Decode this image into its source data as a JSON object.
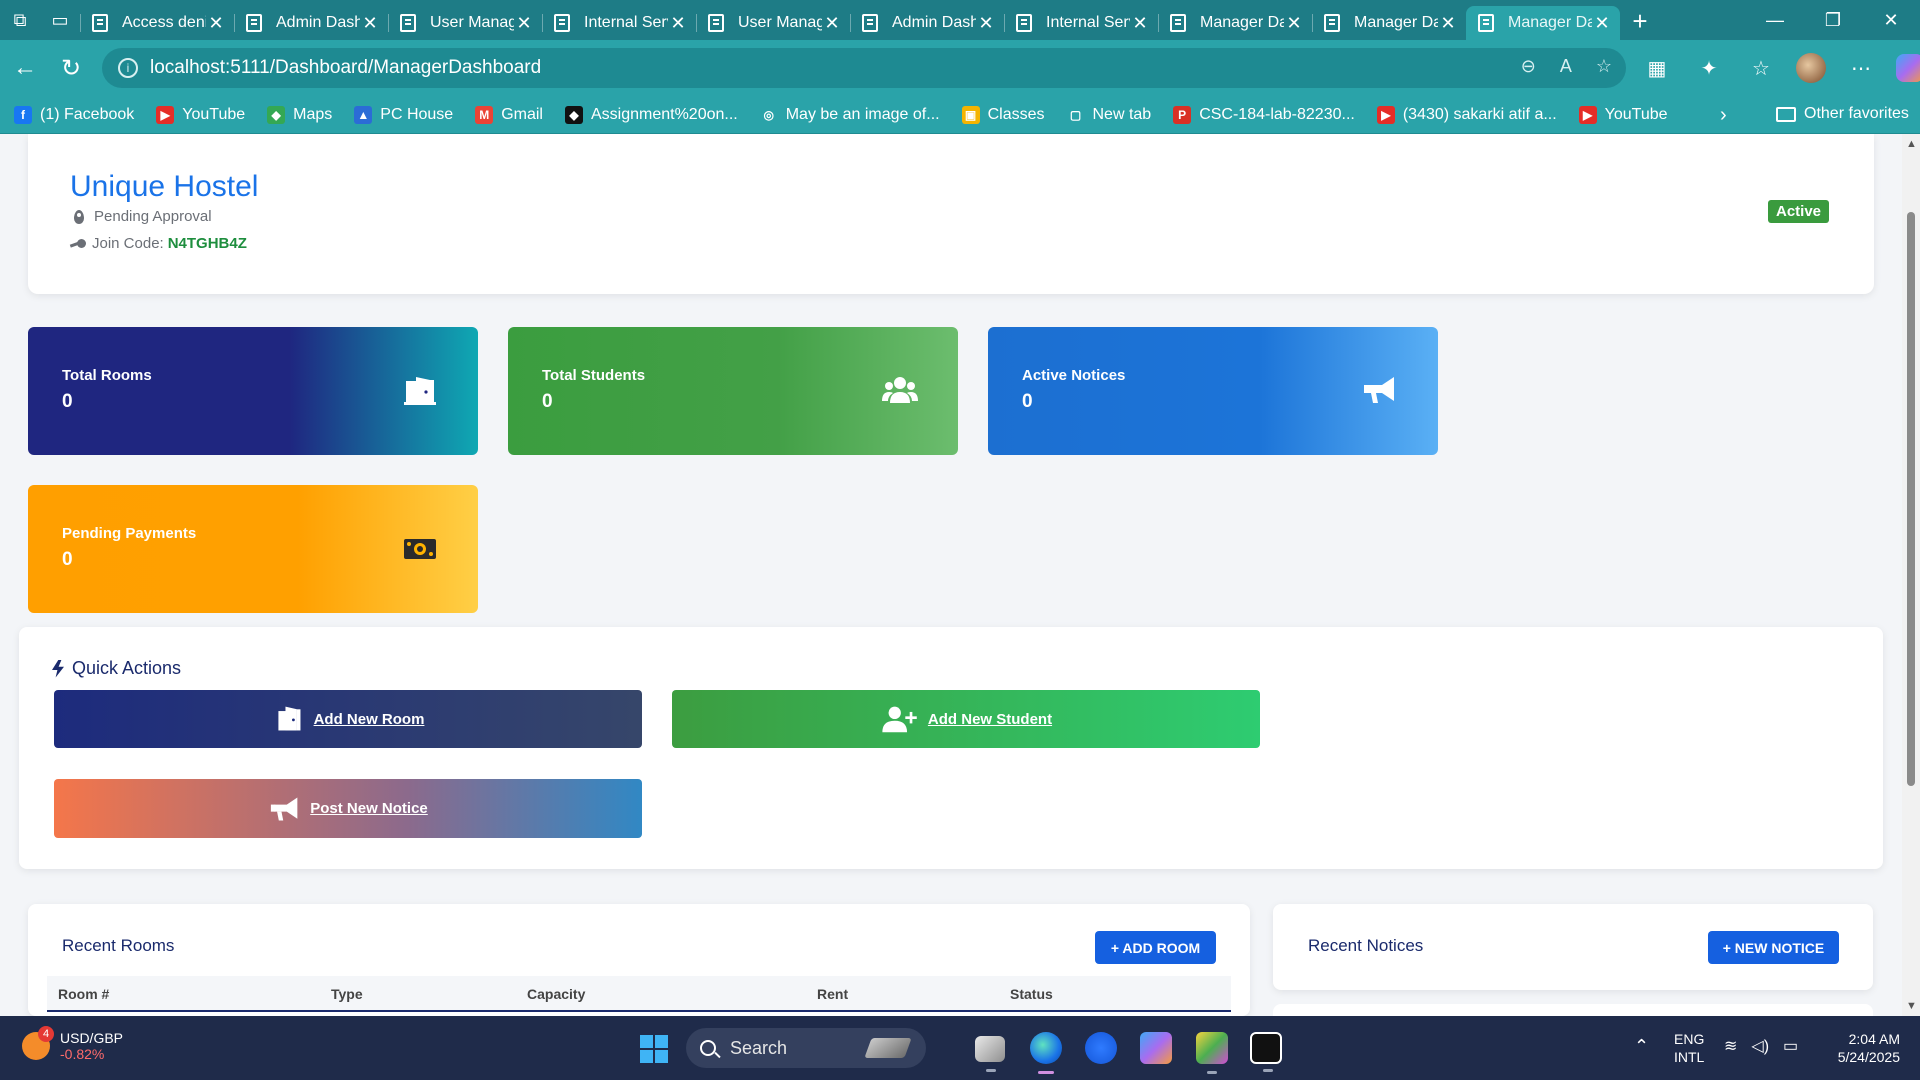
{
  "browser": {
    "tabs": [
      {
        "title": "Access denied",
        "active": false
      },
      {
        "title": "Admin Dashboard",
        "active": false
      },
      {
        "title": "User Management",
        "active": false
      },
      {
        "title": "Internal Server Error",
        "active": false
      },
      {
        "title": "User Management",
        "active": false
      },
      {
        "title": "Admin Dashboard",
        "active": false
      },
      {
        "title": "Internal Server Error",
        "active": false
      },
      {
        "title": "Manager Dashboard",
        "active": false
      },
      {
        "title": "Manager Dashboard",
        "active": false
      },
      {
        "title": "Manager Dashboard",
        "active": true
      }
    ],
    "url": "localhost:5111/Dashboard/ManagerDashboard",
    "favorites": [
      {
        "label": "(1) Facebook",
        "color": "#1877f2",
        "glyph": "f"
      },
      {
        "label": "YouTube",
        "color": "#e52d27",
        "glyph": "▶"
      },
      {
        "label": "Maps",
        "color": "#34a853",
        "glyph": "◆"
      },
      {
        "label": "PC House",
        "color": "#2b6cd6",
        "glyph": "▲"
      },
      {
        "label": "Gmail",
        "color": "#ea4335",
        "glyph": "M"
      },
      {
        "label": "Assignment%20on...",
        "color": "#111111",
        "glyph": "◆"
      },
      {
        "label": "May be an image of...",
        "color": "#2aa3a9",
        "glyph": "◎"
      },
      {
        "label": "Classes",
        "color": "#f4b400",
        "glyph": "▣"
      },
      {
        "label": "New tab",
        "color": "#2aa3a9",
        "glyph": "▢"
      },
      {
        "label": "CSC-184-lab-82230...",
        "color": "#d93025",
        "glyph": "P"
      },
      {
        "label": "(3430) sakarki atif a...",
        "color": "#e52d27",
        "glyph": "▶"
      },
      {
        "label": "YouTube",
        "color": "#e52d27",
        "glyph": "▶"
      }
    ],
    "other_favorites": "Other favorites"
  },
  "hostel": {
    "name": "Unique Hostel",
    "location": "Pending Approval",
    "join_code_label": "Join Code:",
    "join_code": "N4TGHB4Z",
    "status": "Active"
  },
  "stats": [
    {
      "label": "Total Rooms",
      "value": "0",
      "icon": "door-icon"
    },
    {
      "label": "Total Students",
      "value": "0",
      "icon": "users-icon"
    },
    {
      "label": "Active Notices",
      "value": "0",
      "icon": "megaphone-icon"
    },
    {
      "label": "Pending Payments",
      "value": "0",
      "icon": "money-icon"
    }
  ],
  "quick_actions": {
    "title": "Quick Actions",
    "add_room": "Add New Room",
    "add_student": "Add New Student",
    "post_notice": "Post New Notice"
  },
  "recent_rooms": {
    "title": "Recent Rooms",
    "button": "+ ADD ROOM",
    "columns": [
      "Room #",
      "Type",
      "Capacity",
      "Rent",
      "Status"
    ]
  },
  "recent_notices": {
    "title": "Recent Notices",
    "button": "+ NEW NOTICE"
  },
  "taskbar": {
    "ticker": "USD/GBP",
    "ticker_change": "-0.82%",
    "ticker_badge": "4",
    "search": "Search",
    "lang1": "ENG",
    "lang2": "INTL",
    "time": "2:04 AM",
    "date": "5/24/2025"
  }
}
